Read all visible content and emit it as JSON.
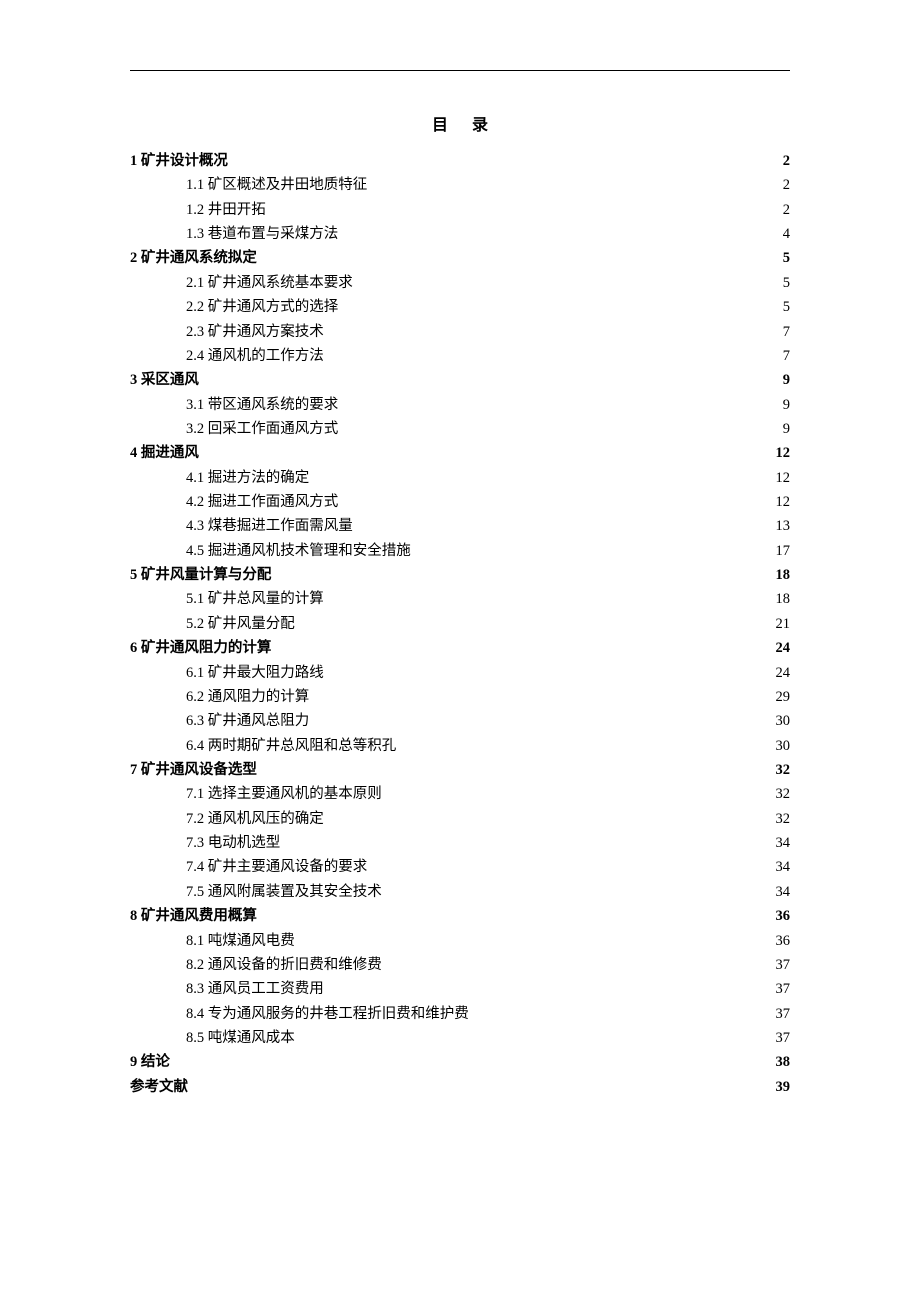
{
  "title": "目录",
  "toc": [
    {
      "level": 1,
      "label": "1 矿井设计概况",
      "page": "2"
    },
    {
      "level": 2,
      "label": "1.1 矿区概述及井田地质特征",
      "page": "2"
    },
    {
      "level": 2,
      "label": "1.2 井田开拓",
      "page": "2"
    },
    {
      "level": 2,
      "label": "1.3 巷道布置与采煤方法",
      "page": "4"
    },
    {
      "level": 1,
      "label": "2 矿井通风系统拟定",
      "page": "5"
    },
    {
      "level": 2,
      "label": "2.1 矿井通风系统基本要求",
      "page": "5"
    },
    {
      "level": 2,
      "label": "2.2 矿井通风方式的选择",
      "page": "5"
    },
    {
      "level": 2,
      "label": "2.3 矿井通风方案技术",
      "page": "7"
    },
    {
      "level": 2,
      "label": "2.4 通风机的工作方法",
      "page": "7"
    },
    {
      "level": 1,
      "label": "3 采区通风",
      "page": "9"
    },
    {
      "level": 2,
      "label": "3.1 带区通风系统的要求",
      "page": "9"
    },
    {
      "level": 2,
      "label": "3.2 回采工作面通风方式",
      "page": "9"
    },
    {
      "level": 1,
      "label": "4 掘进通风",
      "page": "12"
    },
    {
      "level": 2,
      "label": "4.1 掘进方法的确定",
      "page": "12"
    },
    {
      "level": 2,
      "label": "4.2 掘进工作面通风方式",
      "page": "12"
    },
    {
      "level": 2,
      "label": "4.3 煤巷掘进工作面需风量",
      "page": "13"
    },
    {
      "level": 2,
      "label": "4.5 掘进通风机技术管理和安全措施",
      "page": "17"
    },
    {
      "level": 1,
      "label": "5 矿井风量计算与分配",
      "page": "18"
    },
    {
      "level": 2,
      "label": "5.1 矿井总风量的计算",
      "page": "18"
    },
    {
      "level": 2,
      "label": "5.2 矿井风量分配",
      "page": "21"
    },
    {
      "level": 1,
      "label": "6 矿井通风阻力的计算",
      "page": "24"
    },
    {
      "level": 2,
      "label": "6.1 矿井最大阻力路线",
      "page": "24"
    },
    {
      "level": 2,
      "label": "6.2 通风阻力的计算",
      "page": "29"
    },
    {
      "level": 2,
      "label": "6.3 矿井通风总阻力",
      "page": "30"
    },
    {
      "level": 2,
      "label": "6.4 两时期矿井总风阻和总等积孔",
      "page": "30"
    },
    {
      "level": 1,
      "label": "7 矿井通风设备选型",
      "page": "32"
    },
    {
      "level": 2,
      "label": "7.1 选择主要通风机的基本原则",
      "page": "32"
    },
    {
      "level": 2,
      "label": "7.2 通风机风压的确定",
      "page": "32"
    },
    {
      "level": 2,
      "label": "7.3 电动机选型",
      "page": "34"
    },
    {
      "level": 2,
      "label": "7.4 矿井主要通风设备的要求",
      "page": "34"
    },
    {
      "level": 2,
      "label": "7.5 通风附属装置及其安全技术",
      "page": "34"
    },
    {
      "level": 1,
      "label": "8 矿井通风费用概算",
      "page": "36"
    },
    {
      "level": 2,
      "label": "8.1 吨煤通风电费",
      "page": "36"
    },
    {
      "level": 2,
      "label": "8.2 通风设备的折旧费和维修费",
      "page": "37"
    },
    {
      "level": 2,
      "label": "8.3 通风员工工资费用",
      "page": "37"
    },
    {
      "level": 2,
      "label": "8.4 专为通风服务的井巷工程折旧费和维护费",
      "page": "37"
    },
    {
      "level": 2,
      "label": "8.5 吨煤通风成本",
      "page": "37"
    },
    {
      "level": 1,
      "label": "9 结论",
      "page": "38"
    },
    {
      "level": 1,
      "label": "参考文献",
      "page": "39"
    }
  ]
}
